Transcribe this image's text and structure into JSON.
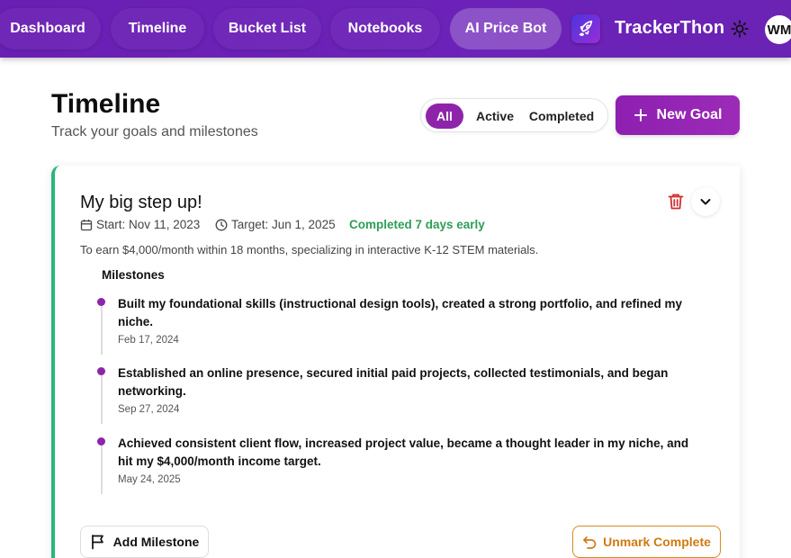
{
  "nav": {
    "items": [
      {
        "label": "Dashboard",
        "active": false
      },
      {
        "label": "Timeline",
        "active": false
      },
      {
        "label": "Bucket List",
        "active": false
      },
      {
        "label": "Notebooks",
        "active": false
      },
      {
        "label": "AI Price Bot",
        "active": true
      }
    ],
    "brand": "TrackerThon",
    "avatar_initials": "WM"
  },
  "header": {
    "title": "Timeline",
    "subtitle": "Track your goals and milestones",
    "filters": [
      "All",
      "Active",
      "Completed"
    ],
    "selected_filter": "All",
    "new_goal_label": "New Goal"
  },
  "goal": {
    "title": "My big step up!",
    "start": "Start: Nov 11, 2023",
    "target": "Target: Jun 1, 2025",
    "status": "Completed 7 days early",
    "description": "To earn $4,000/month within 18 months, specializing in interactive K-12 STEM materials.",
    "milestones_heading": "Milestones",
    "milestones": [
      {
        "text": "Built my foundational skills (instructional design tools), created a strong portfolio, and refined my niche.",
        "date": "Feb 17, 2024"
      },
      {
        "text": "Established an online presence, secured initial paid projects, collected testimonials, and began networking.",
        "date": "Sep 27, 2024"
      },
      {
        "text": "Achieved consistent client flow, increased project value, became a thought leader in my niche, and hit my $4,000/month income target.",
        "date": "May 24, 2025"
      }
    ],
    "add_milestone_label": "Add Milestone",
    "unmark_label": "Unmark Complete"
  },
  "colors": {
    "nav_bg": "#6a1fb4",
    "accent": "#8e24aa",
    "completed_border": "#2bb57b",
    "completed_text": "#2e9e57",
    "unmark": "#d07b12",
    "delete": "#d32f2f"
  }
}
